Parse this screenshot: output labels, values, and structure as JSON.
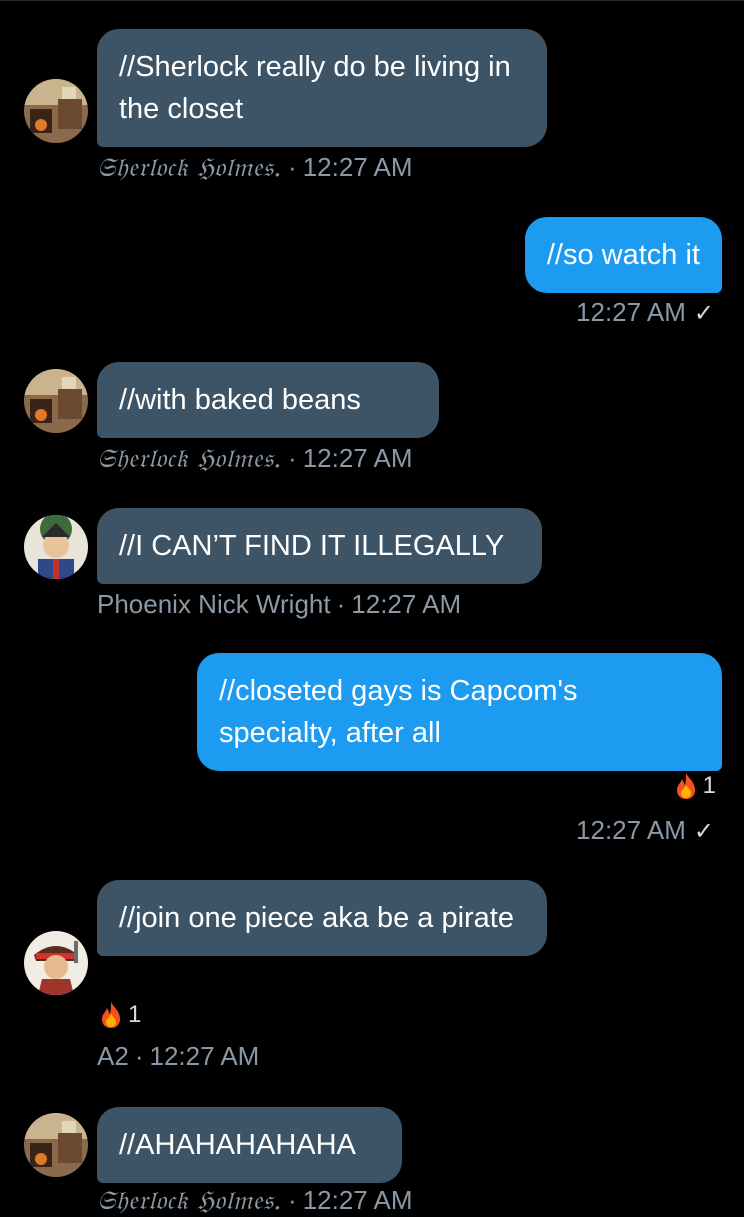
{
  "messages": [
    {
      "text": "//Sherlock really do be living in the closet",
      "sender": "𝔖𝔥𝔢𝔯𝔩𝔬𝔠𝔨 ℌ𝔬𝔩𝔪𝔢𝔰.",
      "time": "12:27 AM"
    },
    {
      "text": "//so watch it",
      "time": "12:27 AM",
      "check": "✓"
    },
    {
      "text": "//with baked beans",
      "sender": "𝔖𝔥𝔢𝔯𝔩𝔬𝔠𝔨 ℌ𝔬𝔩𝔪𝔢𝔰.",
      "time": "12:27 AM"
    },
    {
      "text": "//I CAN’T FIND IT ILLEGALLY",
      "sender": "Phoenix Nick Wright",
      "time": "12:27 AM"
    },
    {
      "text": "//closeted gays is Capcom's specialty, after all",
      "time": "12:27 AM",
      "check": "✓",
      "reaction_count": "1"
    },
    {
      "text": "//join one piece aka be a pirate",
      "sender": "A2",
      "time": "12:27 AM",
      "reaction_count": "1"
    },
    {
      "text": "//AHAHAHAHAHA",
      "sender": "𝔖𝔥𝔢𝔯𝔩𝔬𝔠𝔨 ℌ𝔬𝔩𝔪𝔢𝔰.",
      "time": "12:27 AM"
    }
  ],
  "separator": "·",
  "colors": {
    "received_bubble": "#3d5466",
    "sent_bubble": "#1d9bf0",
    "meta_text": "#8b98a5",
    "background": "#000000"
  },
  "icons": {
    "reaction": "fire-emoji",
    "read_receipt": "check-icon"
  }
}
